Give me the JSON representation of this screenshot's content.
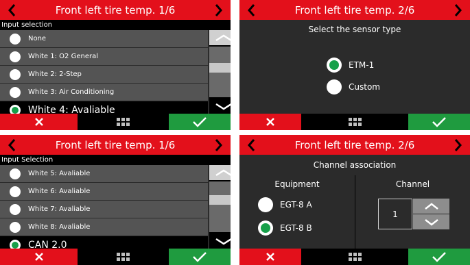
{
  "panel1": {
    "title": "Front left tire temp. 1/6",
    "section_label": "Input selection",
    "items": [
      {
        "label": "None",
        "selected": false
      },
      {
        "label": "White 1: O2 General",
        "selected": false
      },
      {
        "label": "White 2: 2-Step",
        "selected": false
      },
      {
        "label": "White 3: Air Conditioning",
        "selected": false
      },
      {
        "label": "White 4: Avaliable",
        "selected": true
      }
    ]
  },
  "panel2": {
    "title": "Front left tire temp. 2/6",
    "subtitle": "Select the sensor type",
    "options": [
      {
        "label": "ETM-1",
        "selected": true
      },
      {
        "label": "Custom",
        "selected": false
      }
    ]
  },
  "panel3": {
    "title": "Front left tire temp. 1/6",
    "section_label": "Input Selection",
    "items": [
      {
        "label": "White 5: Avaliable",
        "selected": false
      },
      {
        "label": "White 6: Avaliable",
        "selected": false
      },
      {
        "label": "White 7: Avaliable",
        "selected": false
      },
      {
        "label": "White 8: Avaliable",
        "selected": false
      },
      {
        "label": "CAN 2.0",
        "selected": true
      }
    ]
  },
  "panel4": {
    "title": "Front left tire temp. 2/6",
    "subtitle": "Channel association",
    "equipment_header": "Equipment",
    "channel_header": "Channel",
    "options": [
      {
        "label": "EGT-8 A",
        "selected": false
      },
      {
        "label": "EGT-8 B",
        "selected": true
      }
    ],
    "channel_value": "1"
  },
  "colors": {
    "title_bar": "#e3101b",
    "panel_bg": "#2b2b2b",
    "cancel": "#e3101b",
    "confirm": "#1f9b3f",
    "selected_radio": "#17a04a"
  },
  "icons": {
    "prev": "chevron-left-icon",
    "next": "chevron-right-icon",
    "cancel": "close-icon",
    "menu": "grid-menu-icon",
    "confirm": "check-icon",
    "scroll_up": "chevron-up-icon",
    "scroll_down": "chevron-down-icon"
  }
}
